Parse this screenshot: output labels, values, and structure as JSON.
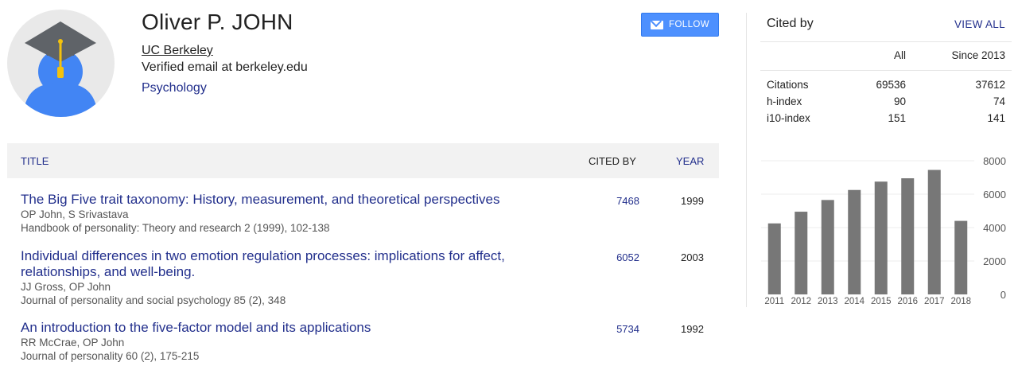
{
  "profile": {
    "name": "Oliver P. JOHN",
    "affiliation": "UC Berkeley",
    "email": "Verified email at berkeley.edu",
    "interest": "Psychology",
    "follow_label": "FOLLOW"
  },
  "table": {
    "headers": {
      "title": "TITLE",
      "cited_by": "CITED BY",
      "year": "YEAR"
    },
    "articles": [
      {
        "title": "The Big Five trait taxonomy: History, measurement, and theoretical perspectives",
        "authors": "OP John, S Srivastava",
        "venue": "Handbook of personality: Theory and research 2 (1999), 102-138",
        "cited_by": "7468",
        "year": "1999"
      },
      {
        "title": "Individual differences in two emotion regulation processes: implications for affect, relationships, and well-being.",
        "authors": "JJ Gross, OP John",
        "venue": "Journal of personality and social psychology 85 (2), 348",
        "cited_by": "6052",
        "year": "2003"
      },
      {
        "title": "An introduction to the five‐factor model and its applications",
        "authors": "RR McCrae, OP John",
        "venue": "Journal of personality 60 (2), 175-215",
        "cited_by": "5734",
        "year": "1992"
      }
    ]
  },
  "cited_by": {
    "title": "Cited by",
    "view_all": "VIEW ALL",
    "col_all": "All",
    "col_since": "Since 2013",
    "rows": [
      {
        "label": "Citations",
        "all": "69536",
        "since": "37612"
      },
      {
        "label": "h-index",
        "all": "90",
        "since": "74"
      },
      {
        "label": "i10-index",
        "all": "151",
        "since": "141"
      }
    ]
  },
  "chart_data": {
    "type": "bar",
    "categories": [
      "2011",
      "2012",
      "2013",
      "2014",
      "2015",
      "2016",
      "2017",
      "2018"
    ],
    "values": [
      4250,
      4950,
      5650,
      6250,
      6750,
      6950,
      7450,
      4400
    ],
    "y_ticks": [
      "0",
      "2000",
      "4000",
      "6000",
      "8000"
    ],
    "ylim": [
      0,
      8000
    ],
    "bar_color": "#777777",
    "grid": true
  },
  "colors": {
    "link": "#222f8c",
    "follow_bg": "#4d90fe",
    "header_bg": "#f2f2f2"
  }
}
